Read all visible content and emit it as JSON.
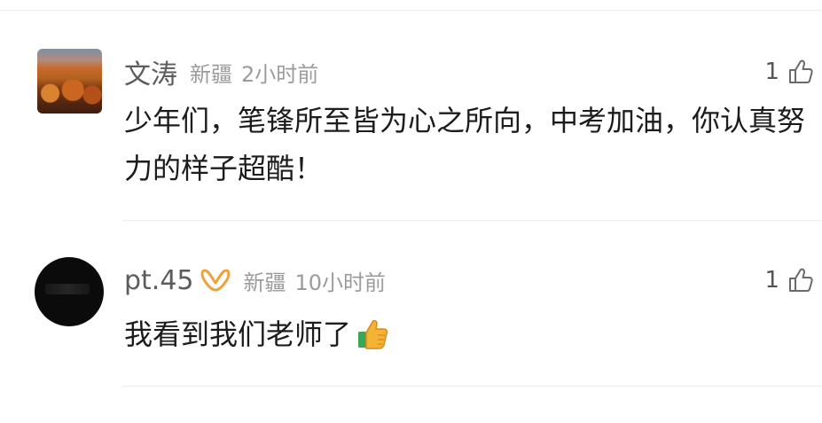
{
  "comments": [
    {
      "username": "文涛",
      "location": "新疆",
      "time": "2小时前",
      "like_count": "1",
      "text": "少年们，笔锋所至皆为心之所向，中考加油，你认真努力的样子超酷！",
      "avatar": "autumn-landscape"
    },
    {
      "username": "pt.45",
      "location": "新疆",
      "time": "10小时前",
      "like_count": "1",
      "text": "我看到我们老师了",
      "avatar": "dark-night"
    }
  ],
  "icons": {
    "like": "thumbs-up-outline-icon",
    "vip": "vip-badge-icon",
    "emoji": "thumbs-up-emoji"
  },
  "colors": {
    "username": "#5c5c5c",
    "meta": "#9b9b9b",
    "body_text": "#1c1c1c",
    "vip_badge": "#f0a23a",
    "divider": "#ebebeb"
  }
}
